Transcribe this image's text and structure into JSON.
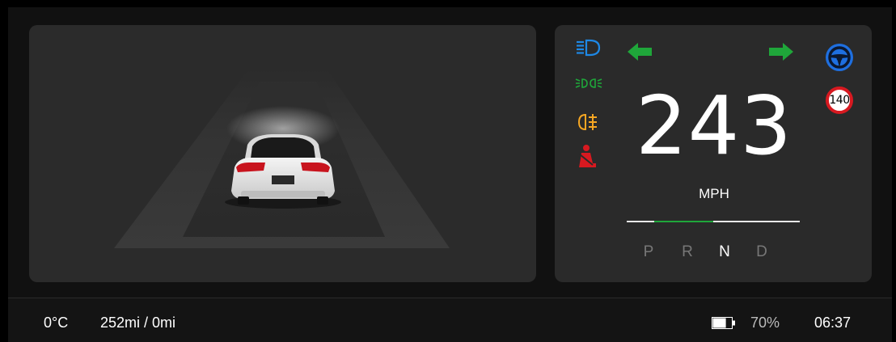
{
  "road_view": {
    "vehicle": "car-rear-view",
    "colors": {
      "panel": "#2b2b2b",
      "lane": "#3a3a3a",
      "car_body": "#e8e8e8",
      "tail_light": "#c8141e"
    }
  },
  "cluster": {
    "speed": "243",
    "speed_unit": "MPH",
    "speed_limit": "140",
    "indicators": [
      {
        "icon": "high-beam-icon",
        "color": "#1e88e5"
      },
      {
        "icon": "parking-lights-icon",
        "color": "#1fa63a"
      },
      {
        "icon": "rear-fog-light-icon",
        "color": "#f5a623"
      },
      {
        "icon": "seatbelt-warning-icon",
        "color": "#d71920"
      },
      {
        "icon": "turn-signal-left-icon",
        "color": "#1fa63a"
      },
      {
        "icon": "turn-signal-right-icon",
        "color": "#1fa63a"
      },
      {
        "icon": "steering-wheel-icon",
        "color": "#1e88e5"
      }
    ],
    "gears": [
      "P",
      "R",
      "N",
      "D"
    ],
    "selected_gear": "N"
  },
  "status_bar": {
    "temperature": "0°C",
    "range": "252mi / 0mi",
    "battery_percent": "70%",
    "battery_level": 0.7,
    "time": "06:37"
  }
}
